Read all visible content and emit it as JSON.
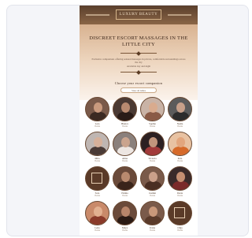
{
  "site": {
    "logo_text": "LUXURY BEAUTY",
    "hero_title": "DISCREET ESCORT MASSAGES IN THE LITTLE CITY",
    "hero_paragraph_1": "Exclusive companions offering sensual massages in private, comfortable surroundings across the city",
    "hero_paragraph_2": "Available day and night",
    "section_title": "Choose your escort companion",
    "cta_button": "View all ladies"
  },
  "colors": {
    "header": "#5a3f2c",
    "accent": "#7a5638",
    "hero_top": "#d8b290",
    "hero_bottom": "#fbf3ec",
    "ring": "#6b4a34"
  },
  "profiles": [
    {
      "name": "Lara",
      "meta": "Vienna",
      "bg": "#7a5a4a",
      "skin": "#c99a7e",
      "body": "#3c2a22"
    },
    {
      "name": "Bianca",
      "meta": "Vienna",
      "bg": "#4a3a34",
      "skin": "#b88a70",
      "body": "#2a1c18"
    },
    {
      "name": "Sophie",
      "meta": "Vienna",
      "bg": "#c9b3a6",
      "skin": "#d9ab8e",
      "body": "#8a5a46"
    },
    {
      "name": "Nadia",
      "meta": "Vienna",
      "bg": "#5b5b5b",
      "skin": "#c7a08a",
      "body": "#2c2c2c"
    },
    {
      "name": "Mila",
      "meta": "Vienna",
      "bg": "#bfb6b2",
      "skin": "#d6b09a",
      "body": "#4a3a36"
    },
    {
      "name": "Alina",
      "meta": "Vienna",
      "bg": "#8a807c",
      "skin": "#caa48e",
      "body": "#ede6e2"
    },
    {
      "name": "Victoria",
      "meta": "Vienna",
      "bg": "#2c2022",
      "skin": "#c2957c",
      "body": "#a23a3a"
    },
    {
      "name": "Kira",
      "meta": "Vienna",
      "bg": "#e8c2a2",
      "skin": "#e2a67e",
      "body": "#d66a2a"
    },
    {
      "name": "Sara",
      "meta": "Vienna",
      "bg": "#5a3a28",
      "skin": "#5a3a28",
      "body": "#5a3a28",
      "placeholder": true
    },
    {
      "name": "Emma",
      "meta": "Vienna",
      "bg": "#6a4a3a",
      "skin": "#b98a6e",
      "body": "#3a241a"
    },
    {
      "name": "Jasmin",
      "meta": "Vienna",
      "bg": "#7a5a4a",
      "skin": "#caa08a",
      "body": "#4a2e22"
    },
    {
      "name": "Daria",
      "meta": "Vienna",
      "bg": "#3a2a2a",
      "skin": "#c48e72",
      "body": "#7a2a2a"
    },
    {
      "name": "Lena",
      "meta": "Vienna",
      "bg": "#c98a6a",
      "skin": "#e2b090",
      "body": "#8a3a2a"
    },
    {
      "name": "Maya",
      "meta": "Vienna",
      "bg": "#6a4a3a",
      "skin": "#b8856a",
      "body": "#2a1a14"
    },
    {
      "name": "Ivana",
      "meta": "Vienna",
      "bg": "#7a5a4a",
      "skin": "#c9987a",
      "body": "#5a3a2a"
    },
    {
      "name": "Olga",
      "meta": "Vienna",
      "bg": "#5a3a28",
      "skin": "#5a3a28",
      "body": "#5a3a28",
      "placeholder": true
    }
  ]
}
